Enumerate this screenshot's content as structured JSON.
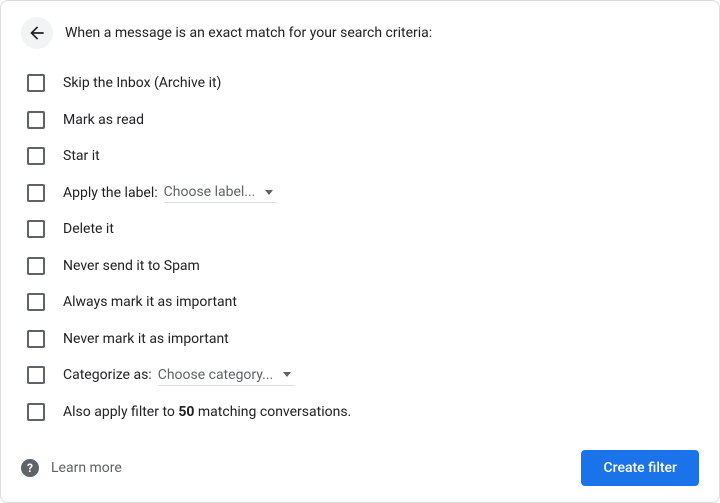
{
  "header": {
    "text": "When a message is an exact match for your search criteria:"
  },
  "options": {
    "skip_inbox": "Skip the Inbox (Archive it)",
    "mark_read": "Mark as read",
    "star_it": "Star it",
    "apply_label_prefix": "Apply the label:",
    "apply_label_dropdown": "Choose label...",
    "delete_it": "Delete it",
    "never_spam": "Never send it to Spam",
    "always_important": "Always mark it as important",
    "never_important": "Never mark it as important",
    "categorize_prefix": "Categorize as:",
    "categorize_dropdown": "Choose category...",
    "also_apply_prefix": "Also apply filter to ",
    "also_apply_count": "50",
    "also_apply_suffix": " matching conversations."
  },
  "footer": {
    "learn_more": "Learn more",
    "help_glyph": "?",
    "create_filter": "Create filter"
  }
}
